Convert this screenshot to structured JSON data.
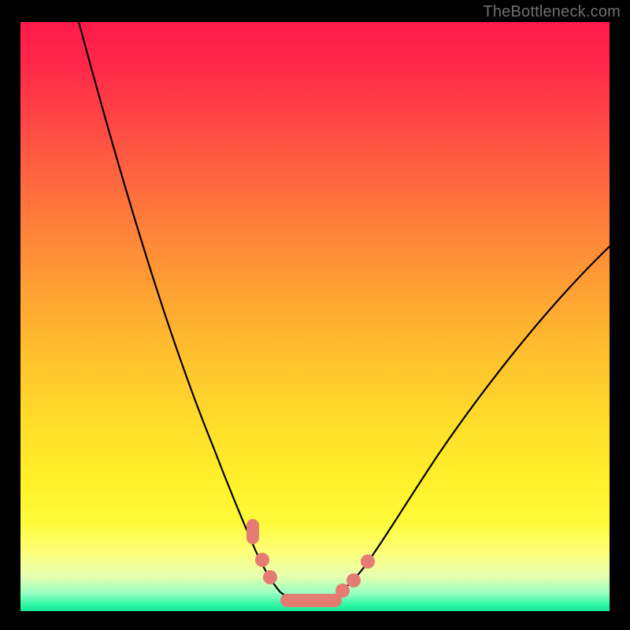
{
  "watermark": "TheBottleneck.com",
  "colors": {
    "background": "#000000",
    "curve": "#000000",
    "marker": "#e47c74",
    "gradient_top": "#ff1a4a",
    "gradient_bottom": "#18e79a"
  },
  "chart_data": {
    "type": "line",
    "title": "",
    "xlabel": "",
    "ylabel": "",
    "xlim": [
      0,
      100
    ],
    "ylim": [
      0,
      100
    ],
    "grid": false,
    "note": "V-shaped bottleneck curve. y measured as % from bottom (0=bottom green, 100=top red). Curve minimum near x≈49, y≈2. Left branch rises steeply to top-left corner; right branch rises more gently toward upper-right.",
    "series": [
      {
        "name": "bottleneck-curve",
        "x": [
          10,
          15,
          20,
          25,
          30,
          35,
          38,
          40,
          42,
          44,
          46,
          48,
          50,
          52,
          54,
          56,
          58,
          62,
          68,
          76,
          86,
          100
        ],
        "y": [
          100,
          84,
          68,
          53,
          40,
          28,
          20,
          14,
          9,
          5,
          3,
          2,
          2,
          2,
          3,
          4,
          6,
          10,
          17,
          27,
          41,
          62
        ]
      }
    ],
    "markers": {
      "note": "Salmon dots/pills along the curve near the valley floor.",
      "points": [
        {
          "x": 39.5,
          "y": 14,
          "shape": "pill-vertical"
        },
        {
          "x": 41.5,
          "y": 8.5,
          "shape": "dot"
        },
        {
          "x": 42.8,
          "y": 5.5,
          "shape": "dot"
        },
        {
          "x": 49,
          "y": 2,
          "shape": "pill-horizontal"
        },
        {
          "x": 54.5,
          "y": 3.2,
          "shape": "dot"
        },
        {
          "x": 56.5,
          "y": 5,
          "shape": "dot"
        },
        {
          "x": 59,
          "y": 8,
          "shape": "dot"
        }
      ]
    }
  }
}
